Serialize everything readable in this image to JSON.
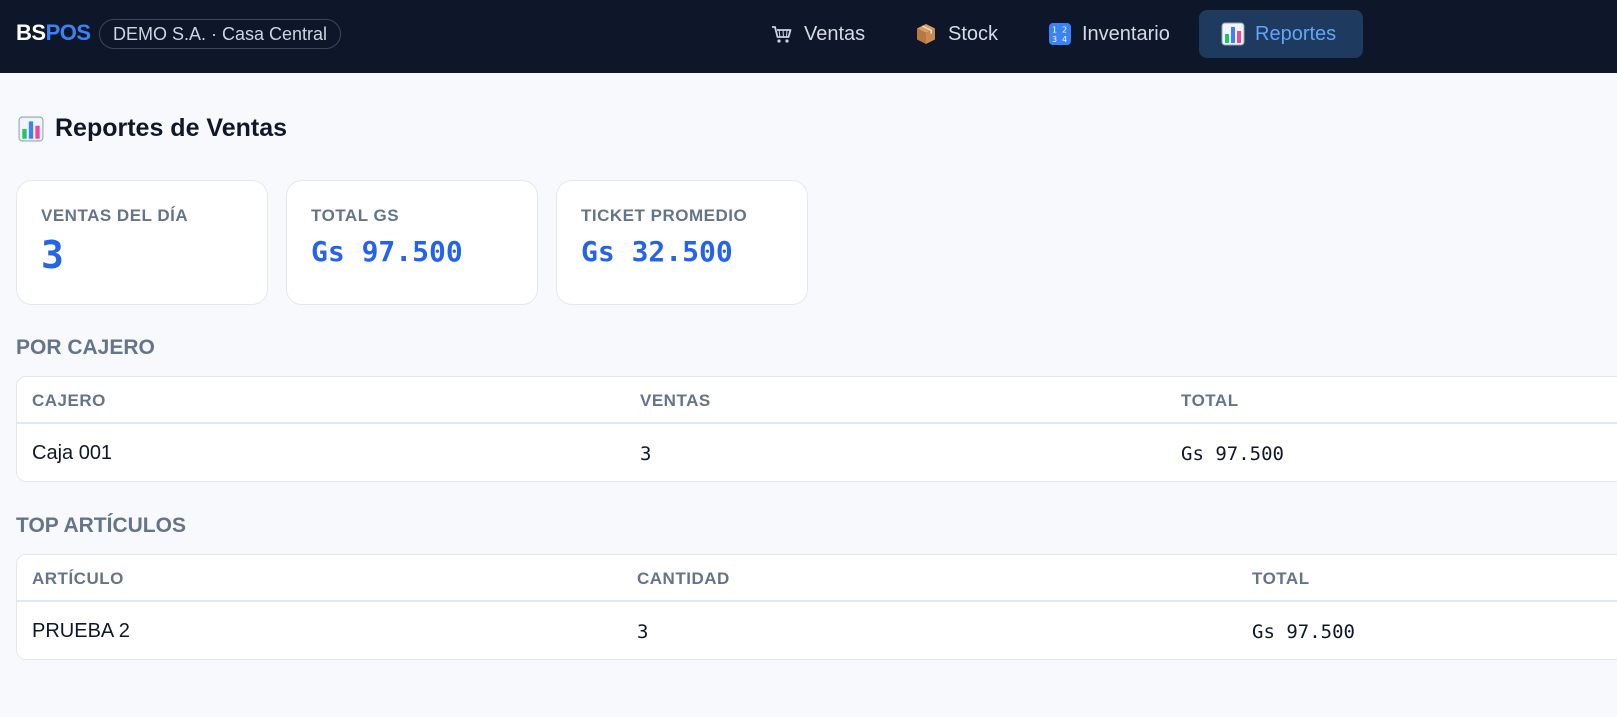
{
  "brand": {
    "part1": "BS",
    "part2": "POS"
  },
  "company": "DEMO S.A. · Casa Central",
  "nav": [
    {
      "label": "Ventas",
      "icon": "cart-icon",
      "active": false
    },
    {
      "label": "Stock",
      "icon": "box-icon",
      "active": false
    },
    {
      "label": "Inventario",
      "icon": "numbers-icon",
      "active": false
    },
    {
      "label": "Reportes",
      "icon": "bar-chart-icon",
      "active": true
    }
  ],
  "page": {
    "title": "Reportes de Ventas",
    "icon": "bar-chart-icon"
  },
  "kpis": [
    {
      "label": "VENTAS DEL DÍA",
      "value": "3"
    },
    {
      "label": "TOTAL GS",
      "value": "Gs 97.500"
    },
    {
      "label": "TICKET PROMEDIO",
      "value": "Gs 32.500"
    }
  ],
  "by_cashier": {
    "title": "POR CAJERO",
    "columns": [
      "CAJERO",
      "VENTAS",
      "TOTAL"
    ],
    "rows": [
      [
        "Caja 001",
        "3",
        "Gs 97.500"
      ]
    ]
  },
  "top_items": {
    "title": "TOP ARTÍCULOS",
    "columns": [
      "ARTÍCULO",
      "CANTIDAD",
      "TOTAL"
    ],
    "rows": [
      [
        "PRUEBA 2",
        "3",
        "Gs 97.500"
      ]
    ]
  },
  "colors": {
    "topbar": "#0e1729",
    "accent": "#2563eb",
    "active_tab_bg": "#1e3a5f",
    "active_tab_text": "#60a5fa",
    "muted": "#64748b"
  }
}
